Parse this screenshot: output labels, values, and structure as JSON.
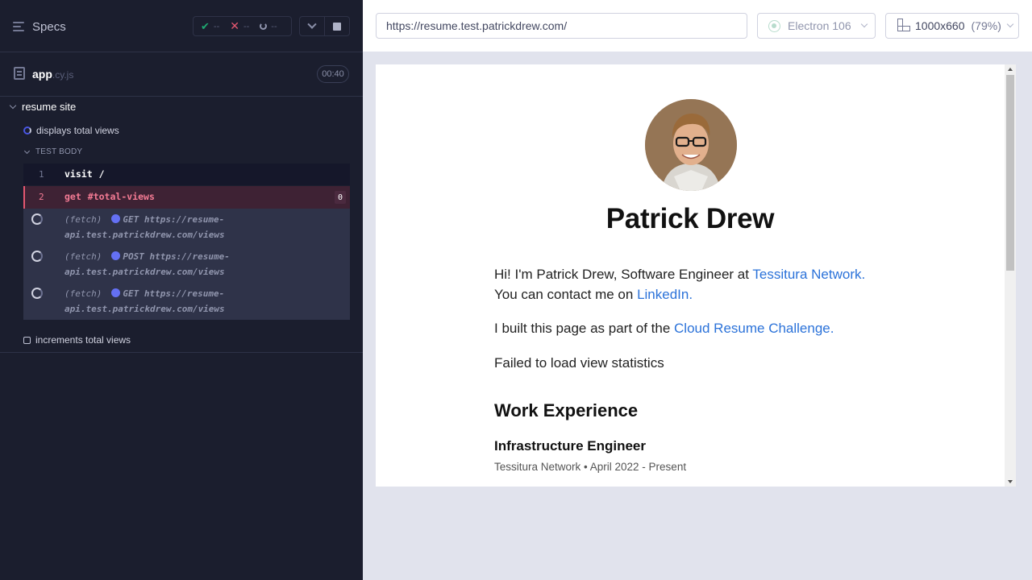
{
  "reporter": {
    "specs_label": "Specs",
    "stats": {
      "passed": "--",
      "failed": "--",
      "pending": "--"
    },
    "spec": {
      "name": "app",
      "ext": ".cy.js",
      "duration": "00:40"
    },
    "suite": "resume site",
    "tests": [
      {
        "title": "displays total views"
      },
      {
        "title": "increments total views"
      }
    ],
    "test_body_label": "TEST BODY",
    "commands": [
      {
        "num": "1",
        "name": "visit",
        "message": "/"
      },
      {
        "num": "2",
        "name": "get",
        "message": "#total-views",
        "count": "0"
      }
    ],
    "fetches": [
      {
        "label": "(fetch)",
        "method": "GET",
        "url_line1": "https://resume-",
        "url_line2": "api.test.patrickdrew.com/views"
      },
      {
        "label": "(fetch)",
        "method": "POST",
        "url_line1": "https://resume-",
        "url_line2": "api.test.patrickdrew.com/views"
      },
      {
        "label": "(fetch)",
        "method": "GET",
        "url_line1": "https://resume-",
        "url_line2": "api.test.patrickdrew.com/views"
      }
    ]
  },
  "topbar": {
    "url": "https://resume.test.patrickdrew.com/",
    "browser": "Electron 106",
    "viewport": "1000x660",
    "zoom": "(79%)"
  },
  "page": {
    "name": "Patrick Drew",
    "intro_text": "Hi! I'm Patrick Drew, Software Engineer at ",
    "intro_link": "Tessitura Network.",
    "contact_text": "You can contact me on ",
    "contact_link": "LinkedIn.",
    "built_text": "I built this page as part of the ",
    "built_link": "Cloud Resume Challenge.",
    "views_status": "Failed to load view statistics",
    "section_title": "Work Experience",
    "job_title": "Infrastructure Engineer",
    "job_meta": "Tessitura Network • April 2022 - Present"
  },
  "colors": {
    "reporter_bg": "#1b1e2e",
    "failed_accent": "#e45770",
    "link": "#2b72d9",
    "fetch_dot": "#6470f3"
  },
  "icons": [
    "specs-list-icon",
    "check-icon",
    "x-icon",
    "pending-icon",
    "chevron-down-icon",
    "stop-icon",
    "file-icon",
    "electron-icon",
    "ruler-icon"
  ]
}
